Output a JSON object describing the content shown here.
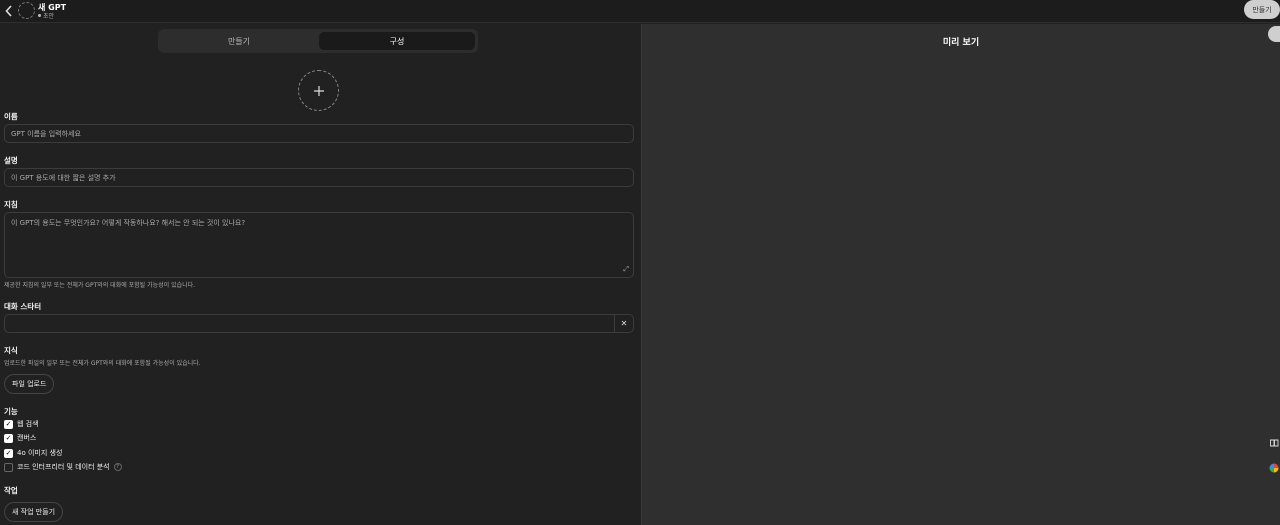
{
  "header": {
    "title": "새 GPT",
    "status": "초안",
    "create_button": "만들기"
  },
  "tabs": [
    {
      "label": "만들기"
    },
    {
      "label": "구성"
    }
  ],
  "form": {
    "name": {
      "label": "이름",
      "placeholder": "GPT 이름을 입력하세요"
    },
    "description": {
      "label": "설명",
      "placeholder": "이 GPT 용도에 대한 짧은 설명 추가"
    },
    "instructions": {
      "label": "지침",
      "placeholder": "이 GPT의 용도는 무엇인가요? 어떻게 작동하나요? 해서는 안 되는 것이 있나요?",
      "hint": "제공한 지침의 일부 또는 전체가 GPT와의 대화에 포함될 가능성이 있습니다."
    },
    "starters": {
      "label": "대화 스타터",
      "value": ""
    },
    "knowledge": {
      "label": "지식",
      "hint": "업로드한 파일의 일부 또는 전체가 GPT와의 대화에 포함될 가능성이 있습니다.",
      "upload_button": "파일 업로드"
    },
    "capabilities": {
      "label": "기능",
      "items": [
        {
          "label": "웹 검색",
          "checked": true
        },
        {
          "label": "캔버스",
          "checked": true
        },
        {
          "label": "4o 이미지 생성",
          "checked": true
        },
        {
          "label": "코드 인터프리터 및 데이터 분석",
          "checked": false
        }
      ]
    },
    "actions": {
      "label": "작업",
      "create_button": "새 작업 만들기"
    }
  },
  "preview": {
    "title": "미리 보기"
  }
}
